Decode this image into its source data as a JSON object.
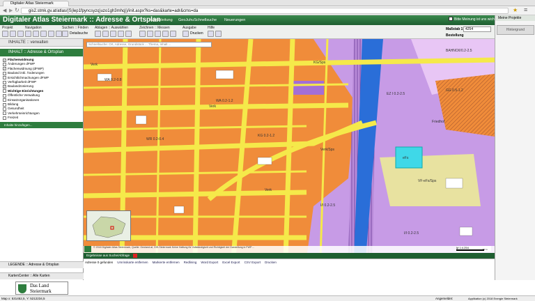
{
  "browser": {
    "tab_title": "Digitaler Atlas Steiermark",
    "url": "gis2.stmk.gv.at/atlas/(S(lep1fpyncsyzq)uzo1gh3mhq))/init.aspx?ks=das&karte=adr&cms=da"
  },
  "app": {
    "title": "Digitaler Atlas Steiermark :: Adresse & Ortsplan",
    "menu": [
      "Kurzanleitung",
      "GeoJuhuSchnellsuche",
      "Neuerungen"
    ],
    "user_note": "Bitte Meinung ist uns wichtig!",
    "meine_projekte": "Meine Projekte"
  },
  "toolbar": {
    "groups": [
      "Projekt",
      "Navigation",
      "Suchen :: Finden",
      "Ablagen :: Auswählen",
      "Zeichnen :: Messen",
      "Ausgabe",
      "Hilfe"
    ],
    "detailsuche": "Detailsuche",
    "drucken": "Drucken",
    "massstab_label": "Maßstab 1:",
    "massstab_value": "4254",
    "bestellung": "Bestellung",
    "hintergrund": "Hintergrund"
  },
  "left_panel": {
    "inhalte_header": "INHALTE :: verwalten",
    "inhalt_header": "INHALT :: Adresse & Ortsplan",
    "items": [
      {
        "label": "Flächenwidmung",
        "checked": true,
        "bold": true
      },
      {
        "label": "Änderungen dFWP",
        "checked": false,
        "bold": false
      },
      {
        "label": "Flächenwidmung (dFWP)",
        "checked": true,
        "bold": false
      },
      {
        "label": "Bauland inkl. Änderungen",
        "checked": false,
        "bold": false
      },
      {
        "label": "Ersichtlichmachungen dFWP",
        "checked": false,
        "bold": false
      },
      {
        "label": "Verfügbarkeit dFWP",
        "checked": false,
        "bold": false
      },
      {
        "label": "Baulandzonierung",
        "checked": true,
        "bold": false
      },
      {
        "label": "Wichtige Einrichtungen",
        "checked": false,
        "bold": true
      },
      {
        "label": "Öffentliche Verwaltung",
        "checked": false,
        "bold": false
      },
      {
        "label": "Einsatzorganisationen",
        "checked": false,
        "bold": false
      },
      {
        "label": "Bildung",
        "checked": false,
        "bold": false
      },
      {
        "label": "Gesundheit",
        "checked": false,
        "bold": false
      },
      {
        "label": "Verkehrseinrichtungen",
        "checked": false,
        "bold": false
      },
      {
        "label": "Freizeit",
        "checked": false,
        "bold": false
      }
    ],
    "add_button": "Inhalte hinzufügen...",
    "legende": "LEGENDE :: Adresse & Ortsplan",
    "kartencenter": "KartenCenter :: Alle Karten",
    "logo_line1": "Das Land",
    "logo_line2": "Steiermark"
  },
  "map": {
    "search_placeholder": "Schnellsuche: Ort, Adresse, Grundstück ... Thema, Inhalt ...",
    "labels": [
      "WA 0.2-0.8",
      "WA 0.2-1.2",
      "WR 0.2-0.4",
      "KG 0.2-1.2",
      "I/I 0.2-2.5",
      "I/I 0.2-2.5",
      "Verk",
      "Verk",
      "Verk",
      "VF-eFs/Sps",
      "Friedhof",
      "eFs",
      "KG/Sps",
      "BAHNO/I/0.2-2.5",
      "EZ I 0.2-2.5",
      "GG 0.5-1.2",
      "Verk/Sps"
    ],
    "scale_text": "M 1:4.254",
    "scale_left": "0",
    "scale_right": "50 m",
    "attribution": "© 2018 Digitaler Atlas Steiermark, Quelle: Geoland.at, GIS-Steiermark Keine Haftung für Vollständigkeit und Richtigkeit der Darstellung in FWP ..."
  },
  "bottom": {
    "panel_title": "Ergebnisse aus Suche/Abfrage",
    "count_text": "Adresse 0 gefunden",
    "actions": [
      "Umrisskarte entfernen",
      "Markierte entfernen",
      "Redlining",
      "Word Export",
      "Excel Export",
      "CSV Export",
      "Drucken"
    ]
  },
  "statusbar": {
    "coords": "Map x: 531452,5, Y: 5212234,5",
    "angemeldet": "Angemeldet:",
    "version": "Applikation (c) 2018 Energie Steiermark"
  }
}
